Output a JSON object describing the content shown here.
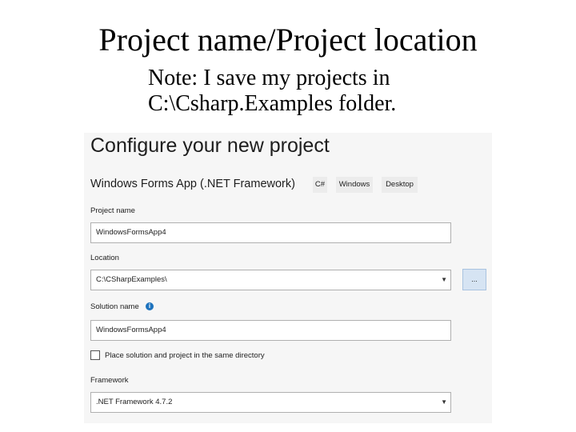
{
  "slide": {
    "title": "Project name/Project location",
    "note_line1": "Note: I save my projects in",
    "note_line2": "C:\\Csharp.Examples folder."
  },
  "dialog": {
    "title": "Configure your new project",
    "template": "Windows Forms App (.NET Framework)",
    "tags": [
      "C#",
      "Windows",
      "Desktop"
    ],
    "project_name_label": "Project name",
    "project_name_value": "WindowsFormsApp4",
    "location_label": "Location",
    "location_value": "C:\\CSharpExamples\\",
    "browse_label": "...",
    "solution_name_label": "Solution name",
    "solution_name_value": "WindowsFormsApp4",
    "same_dir_label": "Place solution and project in the same directory",
    "same_dir_checked": false,
    "framework_label": "Framework",
    "framework_value": ".NET Framework 4.7.2"
  },
  "icons": {
    "info": "info-icon",
    "dropdown": "chevron-down-icon"
  },
  "colors": {
    "browse_button": "#d6e4f3",
    "info_icon": "#1e73be"
  }
}
